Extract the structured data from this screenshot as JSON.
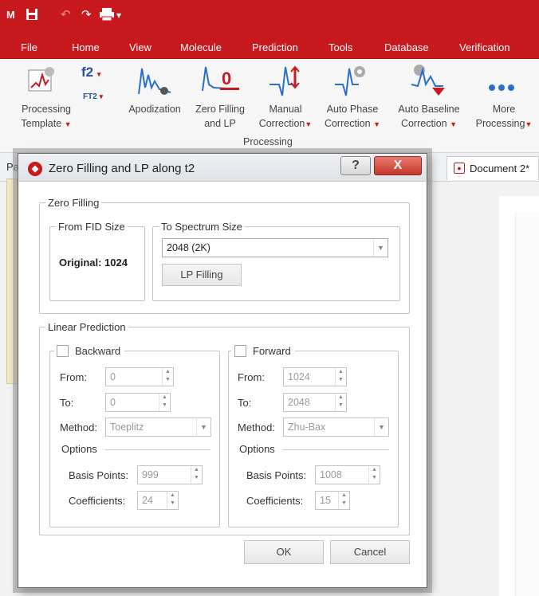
{
  "qat": {
    "app_icon": "M",
    "icons": [
      "save-icon",
      "undo-icon",
      "redo-icon",
      "print-icon",
      "customize-qat-icon"
    ]
  },
  "menu": [
    "File",
    "Home",
    "View",
    "Molecule",
    "Prediction",
    "Tools",
    "Database",
    "Verification"
  ],
  "ribbon": {
    "processing_template": [
      "Processing",
      "Template"
    ],
    "f2": "f2",
    "ft2": "FT2",
    "apodization": "Apodization",
    "zero_filling": [
      "Zero Filling",
      "and LP"
    ],
    "manual_correction": [
      "Manual",
      "Correction"
    ],
    "auto_phase": [
      "Auto Phase",
      "Correction"
    ],
    "auto_baseline": [
      "Auto Baseline",
      "Correction"
    ],
    "more_processing": [
      "More",
      "Processing"
    ],
    "group_label": "Processing"
  },
  "background": {
    "tab_prefix": "Pa",
    "document_tab": "Document 2*"
  },
  "dialog": {
    "title": "Zero Filling and LP along t2",
    "help": "?",
    "close": "X",
    "zero_filling": {
      "legend": "Zero Filling",
      "from_fid_legend": "From FID Size",
      "original": "Original: 1024",
      "to_spectrum_legend": "To Spectrum Size",
      "spectrum_size": "2048 (2K)",
      "lp_filling": "LP Filling"
    },
    "linear_prediction": {
      "legend": "Linear Prediction",
      "backward": {
        "label": "Backward",
        "checked": false,
        "from_label": "From:",
        "from": "0",
        "to_label": "To:",
        "to": "0",
        "method_label": "Method:",
        "method": "Toeplitz",
        "options": "Options",
        "basis_label": "Basis Points:",
        "basis": "999",
        "coef_label": "Coefficients:",
        "coef": "24"
      },
      "forward": {
        "label": "Forward",
        "checked": false,
        "from_label": "From:",
        "from": "1024",
        "to_label": "To:",
        "to": "2048",
        "method_label": "Method:",
        "method": "Zhu-Bax",
        "options": "Options",
        "basis_label": "Basis Points:",
        "basis": "1008",
        "coef_label": "Coefficients:",
        "coef": "15"
      }
    },
    "ok": "OK",
    "cancel": "Cancel"
  }
}
